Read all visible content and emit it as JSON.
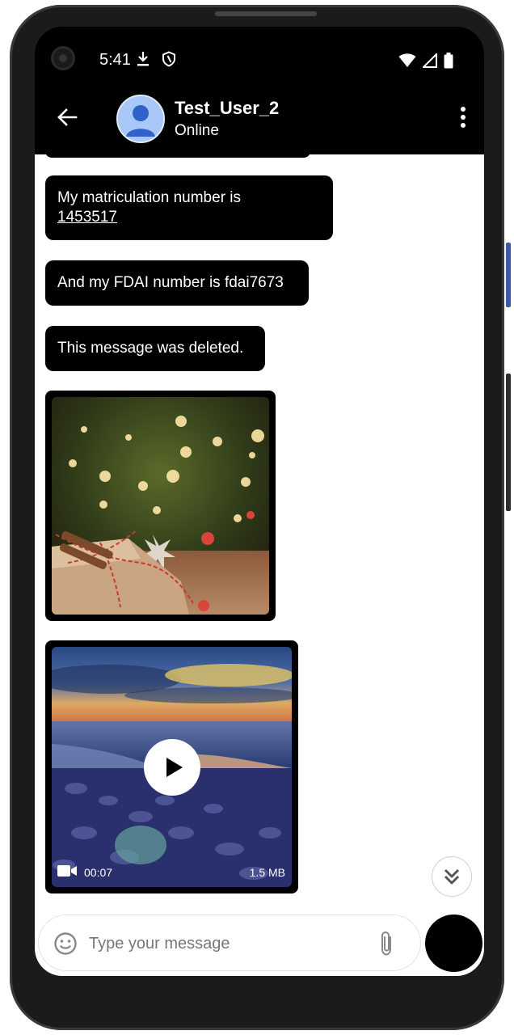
{
  "status_bar": {
    "time": "5:41",
    "icons_left": [
      "download-icon",
      "shield-icon"
    ],
    "icons_right": [
      "wifi-icon",
      "signal-icon",
      "battery-icon"
    ]
  },
  "app_bar": {
    "contact_name": "Test_User_2",
    "contact_status": "Online"
  },
  "messages": [
    {
      "type": "text",
      "text": "My matriculation number is",
      "link": "1453517"
    },
    {
      "type": "text",
      "text": "And my FDAI number is fdai7673"
    },
    {
      "type": "text",
      "text": "This message was deleted."
    },
    {
      "type": "image"
    },
    {
      "type": "video",
      "duration": "00:07",
      "size": "1.5 MB"
    }
  ],
  "composer": {
    "placeholder": "Type your message"
  },
  "colors": {
    "bubble": "#000000",
    "bubble_text": "#ffffff",
    "background": "#ffffff"
  }
}
